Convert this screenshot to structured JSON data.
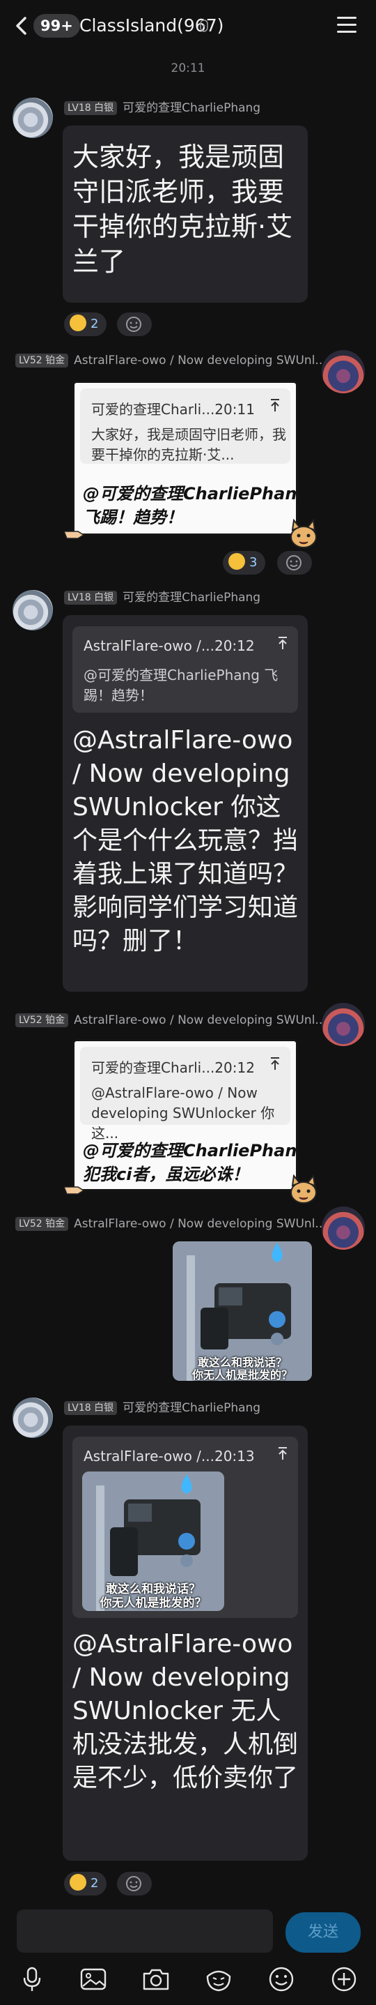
{
  "header": {
    "unread_badge": "99+",
    "group_title": "ClassIsland(967)"
  },
  "timestamp": "20:11",
  "messages": [
    {
      "level": "LV18 白银",
      "sender": "可爱的查理CharliePhang",
      "text": "大家好，我是顽固守旧派老师，我要干掉你的克拉斯·艾兰了",
      "reaction_count": "2"
    },
    {
      "level": "LV52 铂金",
      "sender": "AstralFlare-owo / Now developing SWUnl...",
      "quote_head": "可爱的查理Charli...20:11",
      "quote_body": "大家好，我是顽固守旧老师，我要干掉你的克拉斯·艾...",
      "text_line1": "@可爱的查理CharliePhang",
      "text_line2": "飞踢！趋势！",
      "reaction_count": "3"
    },
    {
      "level": "LV18 白银",
      "sender": "可爱的查理CharliePhang",
      "quote_head": "AstralFlare-owo /...20:12",
      "quote_body": "@可爱的查理CharliePhang 飞踢！趋势！",
      "text": "@AstralFlare-owo / Now developing SWUnlocker 你这个是个什么玩意？挡着我上课了知道吗？影响同学们学习知道吗？删了！"
    },
    {
      "level": "LV52 铂金",
      "sender": "AstralFlare-owo / Now developing SWUnl...",
      "quote_head": "可爱的查理Charli...20:12",
      "quote_body": "@AstralFlare-owo / Now developing SWUnlocker 你这...",
      "text_line1": "@可爱的查理CharliePhang",
      "text_line2": "犯我ci者，虽远必诛！"
    },
    {
      "level": "LV52 铂金",
      "sender": "AstralFlare-owo / Now developing SWUnl...",
      "image_caption_1": "敢这么和我说话？",
      "image_caption_2": "你无人机是批发的？"
    },
    {
      "level": "LV18 白银",
      "sender": "可爱的查理CharliePhang",
      "quote_head": "AstralFlare-owo /...20:13",
      "quote_caption_1": "敢这么和我说话？",
      "quote_caption_2": "你无人机是批发的？",
      "text": "@AstralFlare-owo / Now developing SWUnlocker 无人机没法批发，人机倒是不少，低价卖你了",
      "reaction_count": "2"
    }
  ],
  "input": {
    "send_label": "发送"
  },
  "icons": [
    "back-icon",
    "menu-icon",
    "microphone-icon",
    "image-icon",
    "camera-icon",
    "sticker-icon",
    "emoji-icon",
    "plus-icon"
  ],
  "colors": {
    "background": "#111112",
    "bubble": "#26262a",
    "send_button": "#0e5a8a",
    "reaction_text": "#9ad0ff"
  }
}
